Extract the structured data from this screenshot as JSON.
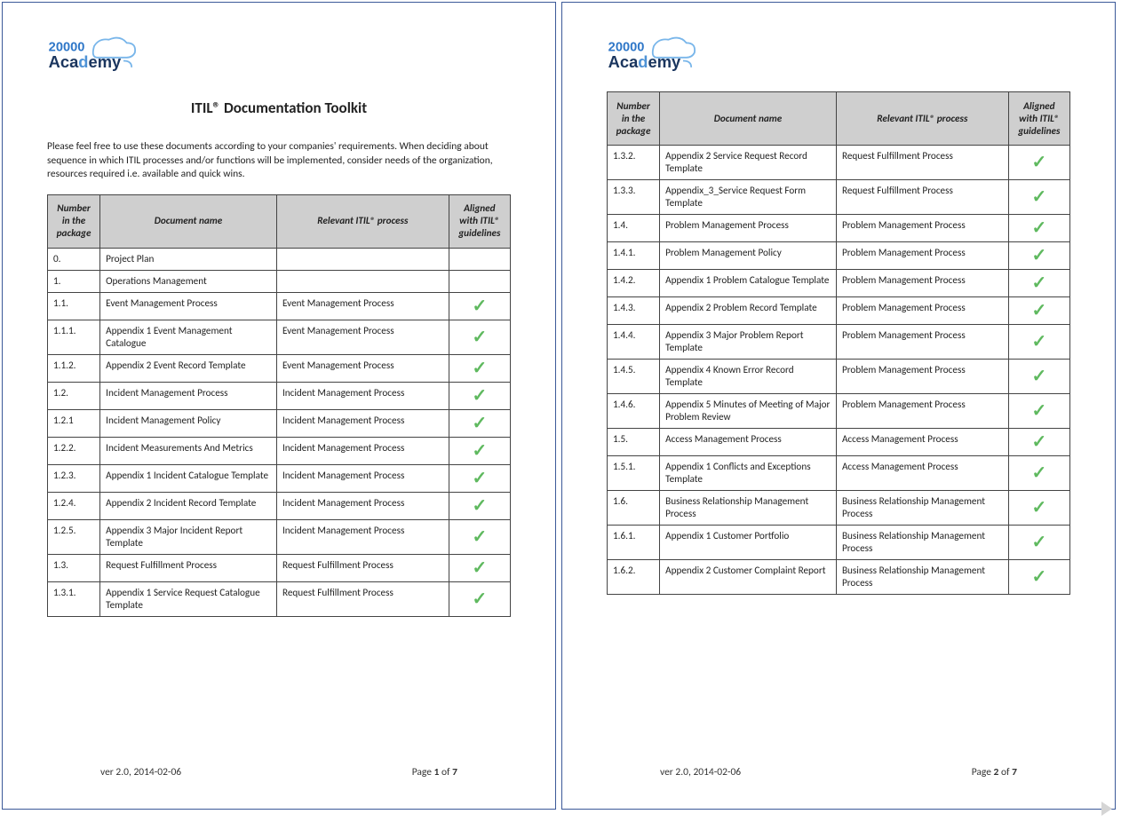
{
  "brand": {
    "line1": "20000",
    "line2_a": "Aca",
    "line2_b": "d",
    "line2_c": "emy"
  },
  "title": "ITIL® Documentation Toolkit",
  "intro": "Please feel free to use these documents according to your companies' requirements. When deciding about sequence in which ITIL processes and/or functions will be implemented, consider needs of the organization, resources required i.e. available and quick wins.",
  "columns": {
    "num": "Number in the package",
    "doc": "Document name",
    "proc": "Relevant ITIL® process",
    "align": "Aligned with ITIL® guidelines"
  },
  "footer": {
    "ver": "ver  2.0, 2014-02-06",
    "page_label": "Page ",
    "of_label": " of ",
    "total": "7",
    "p1": "1",
    "p2": "2"
  },
  "page1_rows": [
    {
      "n": "0.",
      "d": "Project Plan",
      "p": "",
      "c": false
    },
    {
      "n": "1.",
      "d": "Operations Management",
      "p": "",
      "c": false
    },
    {
      "n": "1.1.",
      "d": "Event Management Process",
      "p": "Event Management Process",
      "c": true
    },
    {
      "n": "1.1.1.",
      "d": "Appendix 1 Event Management Catalogue",
      "p": "Event Management Process",
      "c": true
    },
    {
      "n": "1.1.2.",
      "d": "Appendix 2 Event Record Template",
      "p": "Event Management Process",
      "c": true
    },
    {
      "n": "1.2.",
      "d": "Incident Management Process",
      "p": "Incident Management Process",
      "c": true
    },
    {
      "n": "1.2.1",
      "d": "Incident Management Policy",
      "p": "Incident Management Process",
      "c": true
    },
    {
      "n": "1.2.2.",
      "d": "Incident Measurements And Metrics",
      "p": "Incident Management Process",
      "c": true
    },
    {
      "n": "1.2.3.",
      "d": "Appendix 1 Incident Catalogue Template",
      "p": "Incident Management Process",
      "c": true
    },
    {
      "n": "1.2.4.",
      "d": "Appendix 2 Incident Record Template",
      "p": "Incident Management Process",
      "c": true
    },
    {
      "n": "1.2.5.",
      "d": "Appendix 3 Major Incident Report Template",
      "p": "Incident Management Process",
      "c": true
    },
    {
      "n": "1.3.",
      "d": "Request Fulfillment Process",
      "p": "Request Fulfillment Process",
      "c": true
    },
    {
      "n": "1.3.1.",
      "d": "Appendix 1 Service Request Catalogue Template",
      "p": "Request Fulfillment Process",
      "c": true
    }
  ],
  "page2_rows": [
    {
      "n": "1.3.2.",
      "d": "Appendix 2 Service Request Record Template",
      "p": "Request Fulfillment Process",
      "c": true
    },
    {
      "n": "1.3.3.",
      "d": "Appendix_3_Service Request Form Template",
      "p": "Request Fulfillment Process",
      "c": true
    },
    {
      "n": "1.4.",
      "d": "Problem Management Process",
      "p": "Problem Management Process",
      "c": true
    },
    {
      "n": "1.4.1.",
      "d": "Problem Management Policy",
      "p": "Problem Management Process",
      "c": true
    },
    {
      "n": "1.4.2.",
      "d": "Appendix 1 Problem Catalogue Template",
      "p": "Problem Management Process",
      "c": true
    },
    {
      "n": "1.4.3.",
      "d": "Appendix 2 Problem Record Template",
      "p": "Problem Management Process",
      "c": true
    },
    {
      "n": "1.4.4.",
      "d": "Appendix 3 Major Problem Report Template",
      "p": "Problem Management Process",
      "c": true
    },
    {
      "n": "1.4.5.",
      "d": "Appendix 4 Known Error Record Template",
      "p": "Problem Management Process",
      "c": true
    },
    {
      "n": "1.4.6.",
      "d": "Appendix 5 Minutes of Meeting of Major Problem Review",
      "p": "Problem Management Process",
      "c": true
    },
    {
      "n": "1.5.",
      "d": "Access Management Process",
      "p": "Access Management Process",
      "c": true
    },
    {
      "n": "1.5.1.",
      "d": "Appendix 1 Conflicts and Exceptions Template",
      "p": "Access Management Process",
      "c": true
    },
    {
      "n": "1.6.",
      "d": "Business Relationship Management Process",
      "p": "Business Relationship Management Process",
      "c": true
    },
    {
      "n": "1.6.1.",
      "d": "Appendix 1 Customer Portfolio",
      "p": "Business Relationship Management Process",
      "c": true
    },
    {
      "n": "1.6.2.",
      "d": "Appendix 2 Customer Complaint Report",
      "p": "Business Relationship Management Process",
      "c": true
    }
  ]
}
